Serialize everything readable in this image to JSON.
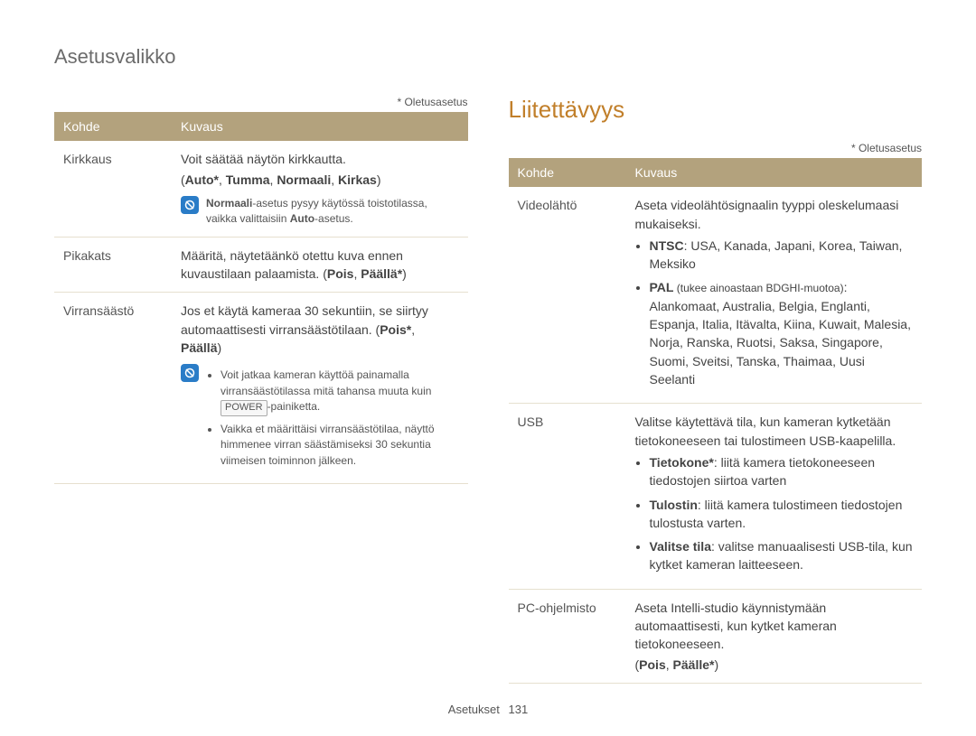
{
  "page_title": "Asetusvalikko",
  "default_label": "* Oletusasetus",
  "table_headers": {
    "kohde": "Kohde",
    "kuvaus": "Kuvaus"
  },
  "left": {
    "rows": {
      "kirkkaus": {
        "key": "Kirkkaus",
        "line1": "Voit säätää näytön kirkkautta.",
        "options_prefix": "(",
        "options_bold": "Auto*",
        "options_rest": ", ",
        "opt_tumma": "Tumma",
        "opt_normaali": "Normaali",
        "opt_kirkas": "Kirkas",
        "options_suffix": ")",
        "note_bold": "Normaali",
        "note_rest1": "-asetus pysyy käytössä toistotilassa, vaikka valittaisiin ",
        "note_bold2": "Auto",
        "note_rest2": "-asetus."
      },
      "pikakats": {
        "key": "Pikakats",
        "line1": "Määritä, näytetäänkö otettu kuva ennen kuvaustilaan palaamista. (",
        "opt_pois": "Pois",
        "sep": ", ",
        "opt_paalla": "Päällä*",
        "suffix": ")"
      },
      "virransaasto": {
        "key": "Virransäästö",
        "line1": "Jos et käytä kameraa 30 sekuntiin, se siirtyy automaattisesti virransäästötilaan. (",
        "opt_pois": "Pois*",
        "sep": ", ",
        "opt_paalla": "Päällä",
        "suffix": ")",
        "bullet1_pre": "Voit jatkaa kameran käyttöä painamalla virransäästötilassa mitä tahansa muuta kuin ",
        "bullet1_key": "POWER",
        "bullet1_post": "-painiketta.",
        "bullet2": "Vaikka et määrittäisi virransäästötilaa, näyttö himmenee virran säästämiseksi 30 sekuntia viimeisen toiminnon jälkeen."
      }
    }
  },
  "right": {
    "heading": "Liitettävyys",
    "rows": {
      "videolahto": {
        "key": "Videolähtö",
        "line1": "Aseta videolähtösignaalin tyyppi oleskelumaasi mukaiseksi.",
        "ntsc_bold": "NTSC",
        "ntsc_rest": ": USA, Kanada, Japani, Korea, Taiwan, Meksiko",
        "pal_bold": "PAL",
        "pal_small": " (tukee ainoastaan BDGHI-muotoa)",
        "pal_rest": ": Alankomaat, Australia, Belgia, Englanti, Espanja, Italia, Itävalta, Kiina, Kuwait, Malesia, Norja, Ranska, Ruotsi, Saksa, Singapore, Suomi, Sveitsi, Tanska, Thaimaa, Uusi Seelanti"
      },
      "usb": {
        "key": "USB",
        "line1": "Valitse käytettävä tila, kun kameran kytketään tietokoneeseen tai tulostimeen USB-kaapelilla.",
        "tieto_bold": "Tietokone*",
        "tieto_rest": ": liitä kamera tietokoneeseen tiedostojen siirtoa varten",
        "tulo_bold": "Tulostin",
        "tulo_rest": ": liitä kamera tulostimeen tiedostojen tulostusta varten.",
        "val_bold": "Valitse tila",
        "val_rest": ": valitse manuaalisesti USB-tila, kun kytket kameran laitteeseen."
      },
      "pcohj": {
        "key": "PC-ohjelmisto",
        "line1": "Aseta Intelli-studio käynnistymään automaattisesti, kun kytket kameran tietokoneeseen.",
        "opts_prefix": "(",
        "opt_pois": "Pois",
        "sep": ", ",
        "opt_paalle": "Päälle*",
        "opts_suffix": ")"
      }
    }
  },
  "footer": {
    "label": "Asetukset",
    "page": "131"
  }
}
